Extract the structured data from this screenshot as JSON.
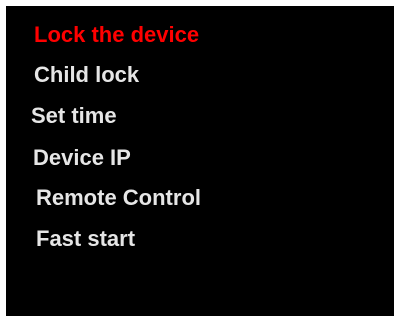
{
  "menu": {
    "selected_color": "#ff0000",
    "text_color": "#e6e6e6",
    "background_color": "#000000",
    "items": [
      {
        "label": "Lock the device",
        "selected": true
      },
      {
        "label": "Child lock",
        "selected": false
      },
      {
        "label": "Set time",
        "selected": false
      },
      {
        "label": "Device IP",
        "selected": false
      },
      {
        "label": "Remote Control",
        "selected": false
      },
      {
        "label": "Fast start",
        "selected": false
      }
    ]
  }
}
